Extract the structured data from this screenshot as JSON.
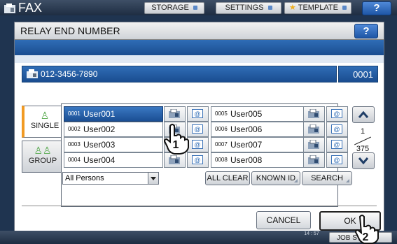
{
  "topbar": {
    "app_title": "FAX",
    "tabs": [
      {
        "label": "STORAGE"
      },
      {
        "label": "SETTINGS"
      },
      {
        "label": "TEMPLATE"
      }
    ],
    "help_label": "?"
  },
  "dialog": {
    "title": "RELAY END NUMBER",
    "help_label": "?",
    "fax_number": "012-3456-7890",
    "count": "0001",
    "tabs": [
      {
        "label": "SINGLE"
      },
      {
        "label": "GROUP"
      }
    ],
    "entries_left": [
      {
        "num": "0001",
        "name": "User001",
        "selected": true
      },
      {
        "num": "0002",
        "name": "User002",
        "selected": false
      },
      {
        "num": "0003",
        "name": "User003",
        "selected": false
      },
      {
        "num": "0004",
        "name": "User004",
        "selected": false
      }
    ],
    "entries_right": [
      {
        "num": "0005",
        "name": "User005",
        "selected": false
      },
      {
        "num": "0006",
        "name": "User006",
        "selected": false
      },
      {
        "num": "0007",
        "name": "User007",
        "selected": false
      },
      {
        "num": "0008",
        "name": "User008",
        "selected": false
      }
    ],
    "pager": {
      "current": "1",
      "total": "375"
    },
    "filter_value": "All Persons",
    "buttons": {
      "all_clear": "ALL CLEAR",
      "known_id": "KNOWN ID",
      "search": "SEARCH",
      "cancel": "CANCEL",
      "ok": "OK"
    },
    "step_markers": [
      "1",
      "2"
    ]
  },
  "statusbar": {
    "time": "14 : 57",
    "job_label": "JOB STATUS"
  },
  "colors": {
    "accent_blue": "#2f6db6",
    "selected_tab_accent": "#f19a23",
    "background": "#1f3450"
  }
}
